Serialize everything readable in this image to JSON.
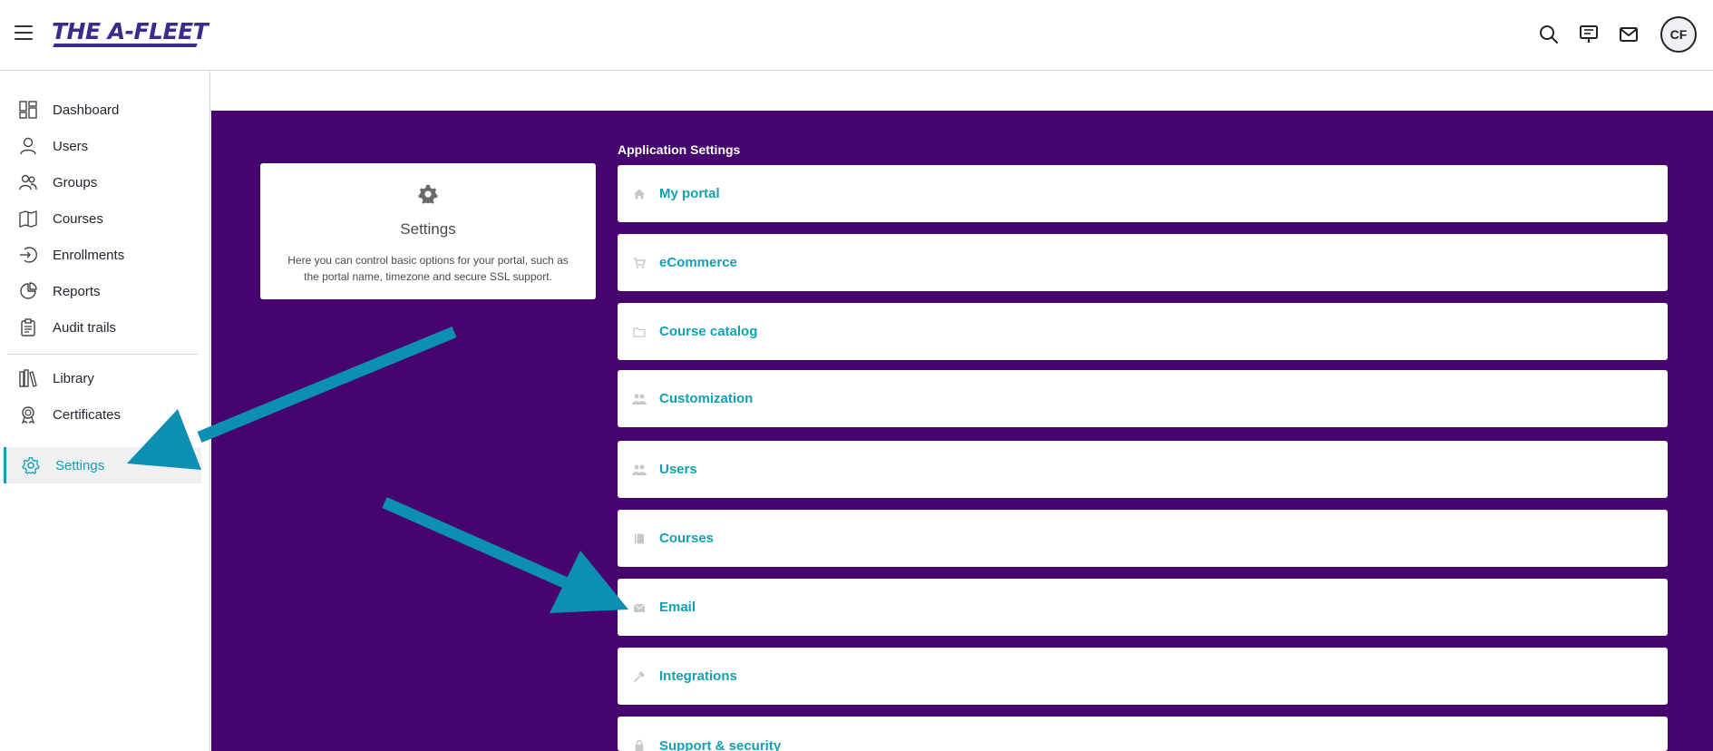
{
  "header": {
    "logo_text": "THE A-FLEET",
    "avatar_initials": "CF",
    "icons": [
      "menu-icon",
      "search-icon",
      "presentation-icon",
      "mail-icon"
    ]
  },
  "sidebar": {
    "items": [
      {
        "label": "Dashboard",
        "icon": "dashboard-icon"
      },
      {
        "label": "Users",
        "icon": "user-icon"
      },
      {
        "label": "Groups",
        "icon": "groups-icon"
      },
      {
        "label": "Courses",
        "icon": "book-icon"
      },
      {
        "label": "Enrollments",
        "icon": "enroll-icon"
      },
      {
        "label": "Reports",
        "icon": "pie-chart-icon"
      },
      {
        "label": "Audit trails",
        "icon": "clipboard-icon"
      },
      {
        "label": "Library",
        "icon": "library-icon"
      },
      {
        "label": "Certificates",
        "icon": "award-icon"
      },
      {
        "label": "Settings",
        "icon": "gear-icon",
        "active": true
      }
    ]
  },
  "settings_card": {
    "title": "Settings",
    "description": "Here you can control basic options for your portal, such as the portal name, timezone and secure SSL support."
  },
  "application_settings": {
    "heading": "Application Settings",
    "items": [
      {
        "label": "My portal",
        "icon": "home-icon"
      },
      {
        "label": "eCommerce",
        "icon": "cart-icon"
      },
      {
        "label": "Course catalog",
        "icon": "folder-icon"
      },
      {
        "label": "Customization",
        "icon": "users-icon"
      },
      {
        "label": "Users",
        "icon": "users-icon"
      },
      {
        "label": "Courses",
        "icon": "book-icon"
      },
      {
        "label": "Email",
        "icon": "envelope-icon"
      },
      {
        "label": "Integrations",
        "icon": "plug-icon"
      },
      {
        "label": "Support & security",
        "icon": "lock-icon"
      }
    ]
  },
  "colors": {
    "brand_purple": "#46046f",
    "accent_teal": "#12a0b2",
    "arrow_blue": "#0d8fb3",
    "logo_purple": "#3c2a8c"
  }
}
